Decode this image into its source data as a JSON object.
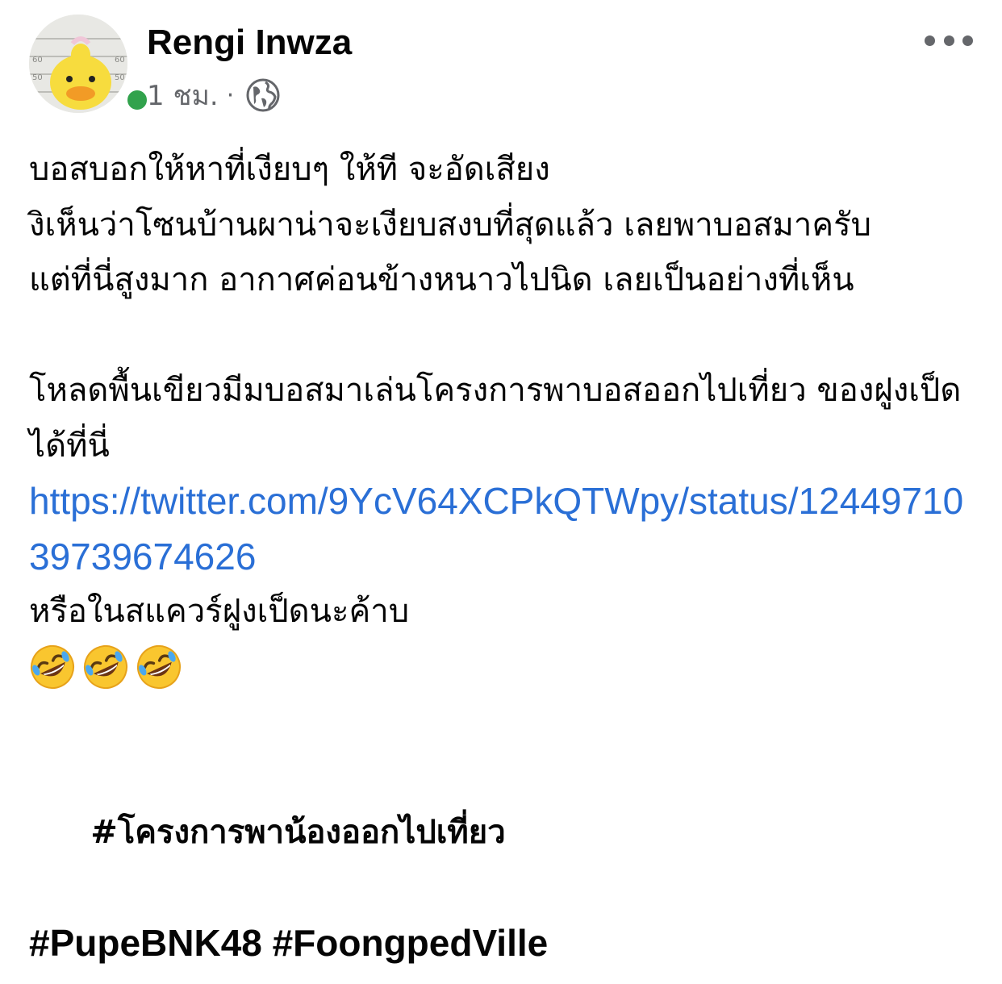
{
  "post": {
    "author": {
      "name": "Rengi Inwza",
      "online_color": "#31a24c"
    },
    "meta": {
      "time": "1 ชม.",
      "separator": "·",
      "privacy_icon": "globe-icon"
    },
    "more_icon": "more-horizontal-icon",
    "body": {
      "lines": [
        "บอสบอกให้หาที่เงียบๆ ให้ที จะอัดเสียง",
        "งิเห็นว่าโซนบ้านผาน่าจะเงียบสงบที่สุดแล้ว เลยพาบอสมาครับ",
        "แต่ที่นี่สูงมาก อากาศค่อนข้างหนาวไปนิด เลยเป็นอย่างที่เห็น"
      ],
      "line2": "โหลดพื้นเขียวมีมบอสมาเล่นโครงการพาบอสออกไปเที่ยว ของฝูงเป็ดได้ที่นี่",
      "link": "https://twitter.com/9YcV64XCPkQTWpy/status/1244971039739674626",
      "line3": "หรือในสแควร์ฝูงเป็ดนะค้าบ",
      "emoji_icon": "rolling-on-floor-laughing-icon",
      "emoji_count": 3
    },
    "hashtags": {
      "thai": "#โครงการพาน้องออกไปเที่ยว",
      "tag2": "#PupeBNK48",
      "tag3": "#FoongpedVille"
    },
    "colors": {
      "link": "#2a6fd6",
      "meta_text": "#65676b",
      "text": "#050505"
    }
  }
}
